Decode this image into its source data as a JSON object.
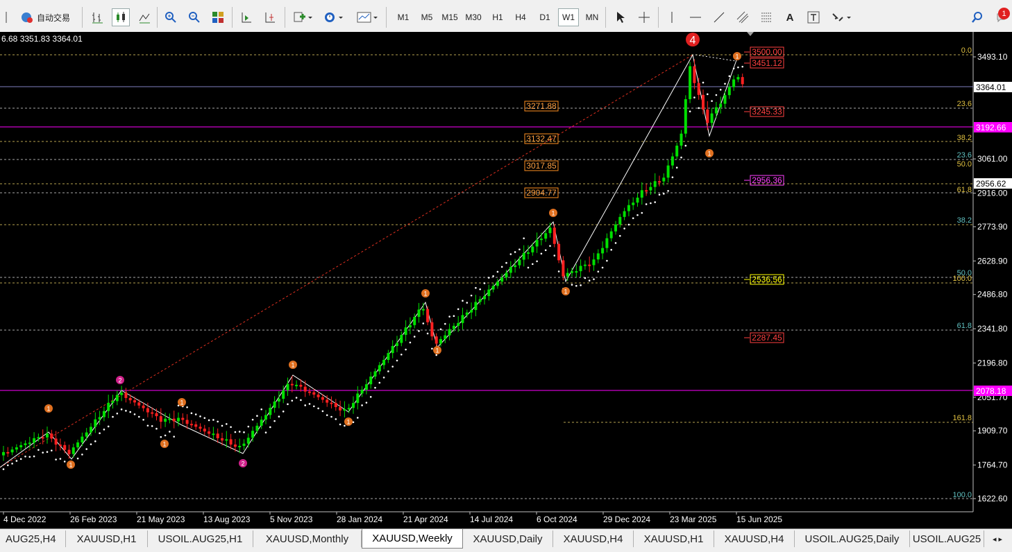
{
  "toolbar": {
    "autotrade_label": "自动交易",
    "timeframes": [
      "M1",
      "M5",
      "M15",
      "M30",
      "H1",
      "H4",
      "D1",
      "W1",
      "MN"
    ],
    "selected_timeframe": "W1",
    "notification_count": "1"
  },
  "chart": {
    "ohlc_info": "6.68 3351.83 3364.01",
    "wave_label": "4",
    "price_axis": {
      "ticks": [
        "3493.10",
        "3061.00",
        "2916.00",
        "2773.90",
        "2628.90",
        "2486.80",
        "2341.80",
        "2196.80",
        "2051.70",
        "1909.70",
        "1764.70",
        "1622.60"
      ],
      "range": [
        1580.0,
        3590.0
      ]
    },
    "current_price": "3364.01",
    "level_boxes": [
      "3192.66",
      "2956.62",
      "2078.18"
    ],
    "date_axis": [
      "4 Dec 2022",
      "26 Feb 2023",
      "21 May 2023",
      "13 Aug 2023",
      "5 Nov 2023",
      "28 Jan 2024",
      "21 Apr 2024",
      "14 Jul 2024",
      "6 Oct 2024",
      "29 Dec 2024",
      "23 Mar 2025",
      "15 Jun 2025"
    ],
    "left_price_labels": [
      "3271.88",
      "3132.47",
      "3017.85",
      "2904.77"
    ],
    "right_price_labels": [
      {
        "text": "3500.00",
        "color": "#ff4040"
      },
      {
        "text": "3451.12",
        "color": "#ff4040"
      },
      {
        "text": "3245.33",
        "color": "#ff4040"
      },
      {
        "text": "2956.36",
        "color": "#ff40ff"
      },
      {
        "text": "2536.56",
        "color": "#ffff00"
      },
      {
        "text": "2287.45",
        "color": "#ff4040"
      }
    ],
    "fib_labels": [
      {
        "text": "0.0",
        "color": "#e0c040"
      },
      {
        "text": "23.6",
        "color": "#e0c040"
      },
      {
        "text": "38.2",
        "color": "#e0c040"
      },
      {
        "text": "23.6",
        "color": "#60c0c0"
      },
      {
        "text": "50.0",
        "color": "#e0c040"
      },
      {
        "text": "61.8",
        "color": "#e0c040"
      },
      {
        "text": "38.2",
        "color": "#60c0c0"
      },
      {
        "text": "50.0",
        "color": "#60c0c0"
      },
      {
        "text": "100.0",
        "color": "#e0c040"
      },
      {
        "text": "61.8",
        "color": "#60c0c0"
      },
      {
        "text": "161.8",
        "color": "#e0c040"
      },
      {
        "text": "100.0",
        "color": "#60c0c0"
      }
    ],
    "wave_markers": [
      "1",
      "2",
      "1",
      "1",
      "2",
      "1",
      "1",
      "1",
      "1",
      "1",
      "1",
      "1",
      "1"
    ]
  },
  "tabs": [
    "XAUUSD,H4",
    "XAUUSD,H1",
    "USOIL.AUG25,H1",
    "XAUUSD,Monthly",
    "XAUUSD,Weekly",
    "XAUUSD,Daily",
    "XAUUSD,H4",
    "XAUUSD,H1",
    "XAUUSD,H4",
    "USOIL.AUG25,Daily",
    "USOIL.AUG25"
  ],
  "tab_first_label": "AUG25,H4",
  "active_tab": "XAUUSD,Weekly",
  "colors": {
    "bull": "#00e000",
    "bear": "#ff2020",
    "magenta": "#ff00ff",
    "background": "#000000"
  }
}
